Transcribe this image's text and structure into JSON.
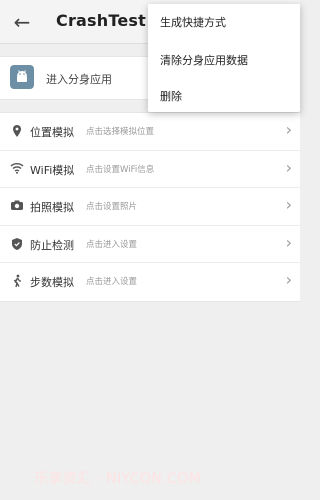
{
  "appbar": {
    "title": "CrashTest"
  },
  "clone": {
    "label": "进入分身应用"
  },
  "rows": [
    {
      "label": "位置模拟",
      "hint": "点击选择模拟位置",
      "icon": "location-pin-icon"
    },
    {
      "label": "WiFi模拟",
      "hint": "点击设置WiFi信息",
      "icon": "wifi-icon"
    },
    {
      "label": "拍照模拟",
      "hint": "点击设置照片",
      "icon": "camera-icon"
    },
    {
      "label": "防止检测",
      "hint": "点击进入设置",
      "icon": "shield-check-icon"
    },
    {
      "label": "步数模拟",
      "hint": "点击进入设置",
      "icon": "walking-icon"
    }
  ],
  "menu": {
    "items": [
      {
        "label": "生成快捷方式"
      },
      {
        "label": "清除分身应用数据"
      },
      {
        "label": "删除"
      }
    ]
  },
  "watermark": {
    "text": "乐享资汇 · NIYCON.COM"
  },
  "colors": {
    "app_icon_bg": "#6c8fa5",
    "background": "#efefef"
  }
}
